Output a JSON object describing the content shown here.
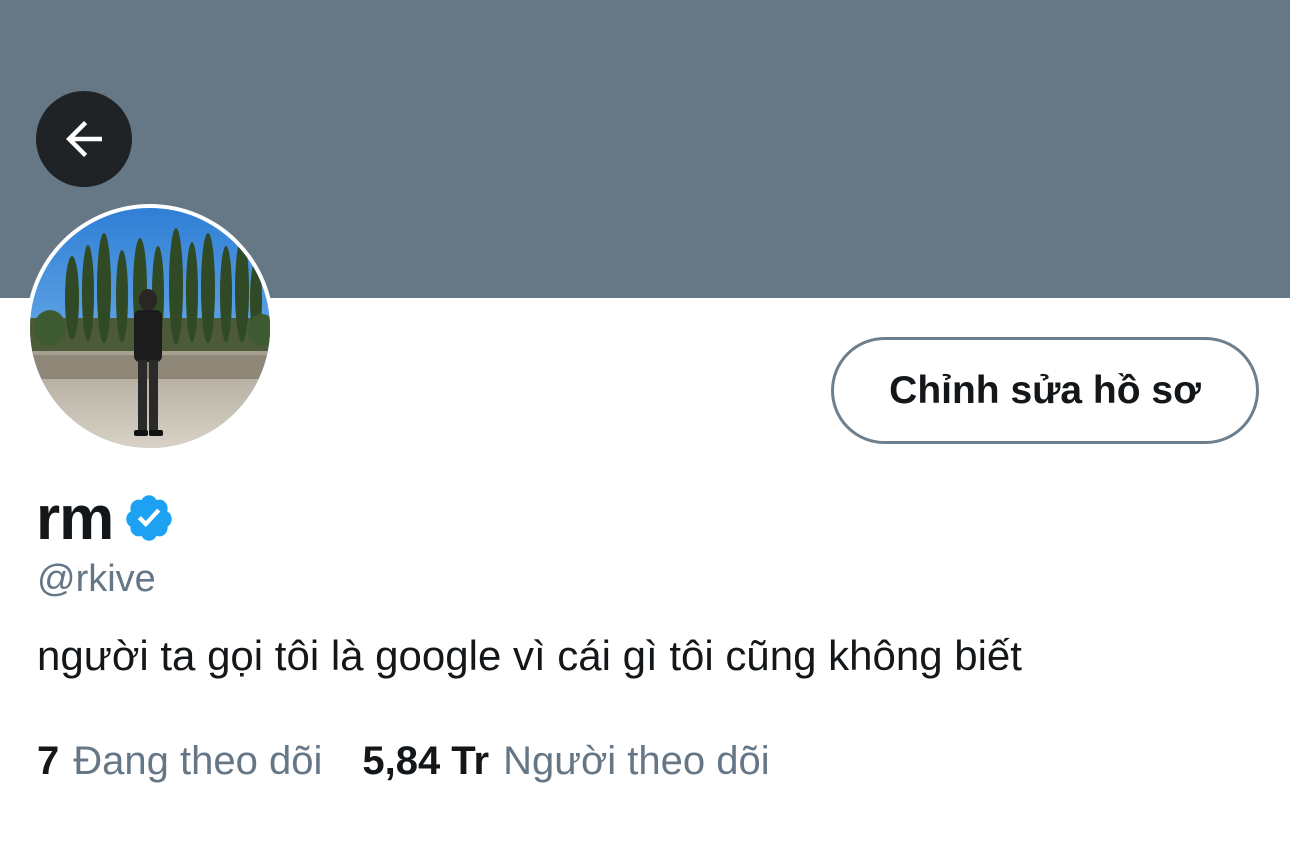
{
  "header": {
    "banner_color": "#667886",
    "back_icon": "arrow-left-icon"
  },
  "profile": {
    "display_name": "rm",
    "verified_icon": "verified-badge-icon",
    "verified_color": "#1da1f2",
    "handle": "@rkive",
    "bio": "người ta gọi tôi là google vì cái gì tôi cũng không biết",
    "edit_button_label": "Chỉnh sửa hồ sơ"
  },
  "stats": {
    "following_count": "7",
    "following_label": "Đang theo dõi",
    "followers_count": "5,84 Tr",
    "followers_label": "Người theo dõi"
  }
}
